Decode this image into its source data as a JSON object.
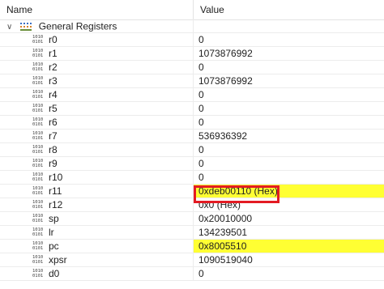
{
  "columns": {
    "name": "Name",
    "value": "Value"
  },
  "group": {
    "label": "General Registers",
    "expanded": true,
    "icon": "register-group-icon"
  },
  "register_icon_text": [
    "1010",
    "0101"
  ],
  "highlight_color": "#ffff33",
  "annotation_color": "#e31b23",
  "registers": [
    {
      "name": "r0",
      "value": "0",
      "highlighted": false
    },
    {
      "name": "r1",
      "value": "1073876992",
      "highlighted": false
    },
    {
      "name": "r2",
      "value": "0",
      "highlighted": false
    },
    {
      "name": "r3",
      "value": "1073876992",
      "highlighted": false
    },
    {
      "name": "r4",
      "value": "0",
      "highlighted": false
    },
    {
      "name": "r5",
      "value": "0",
      "highlighted": false
    },
    {
      "name": "r6",
      "value": "0",
      "highlighted": false
    },
    {
      "name": "r7",
      "value": "536936392",
      "highlighted": false
    },
    {
      "name": "r8",
      "value": "0",
      "highlighted": false
    },
    {
      "name": "r9",
      "value": "0",
      "highlighted": false
    },
    {
      "name": "r10",
      "value": "0",
      "highlighted": false
    },
    {
      "name": "r11",
      "value": "0xdeb00110 (Hex)",
      "highlighted": true
    },
    {
      "name": "r12",
      "value": "0x0 (Hex)",
      "highlighted": false
    },
    {
      "name": "sp",
      "value": "0x20010000",
      "highlighted": false
    },
    {
      "name": "lr",
      "value": "134239501",
      "highlighted": false
    },
    {
      "name": "pc",
      "value": "0x8005510",
      "highlighted": true
    },
    {
      "name": "xpsr",
      "value": "1090519040",
      "highlighted": false
    },
    {
      "name": "d0",
      "value": "0",
      "highlighted": false
    }
  ]
}
